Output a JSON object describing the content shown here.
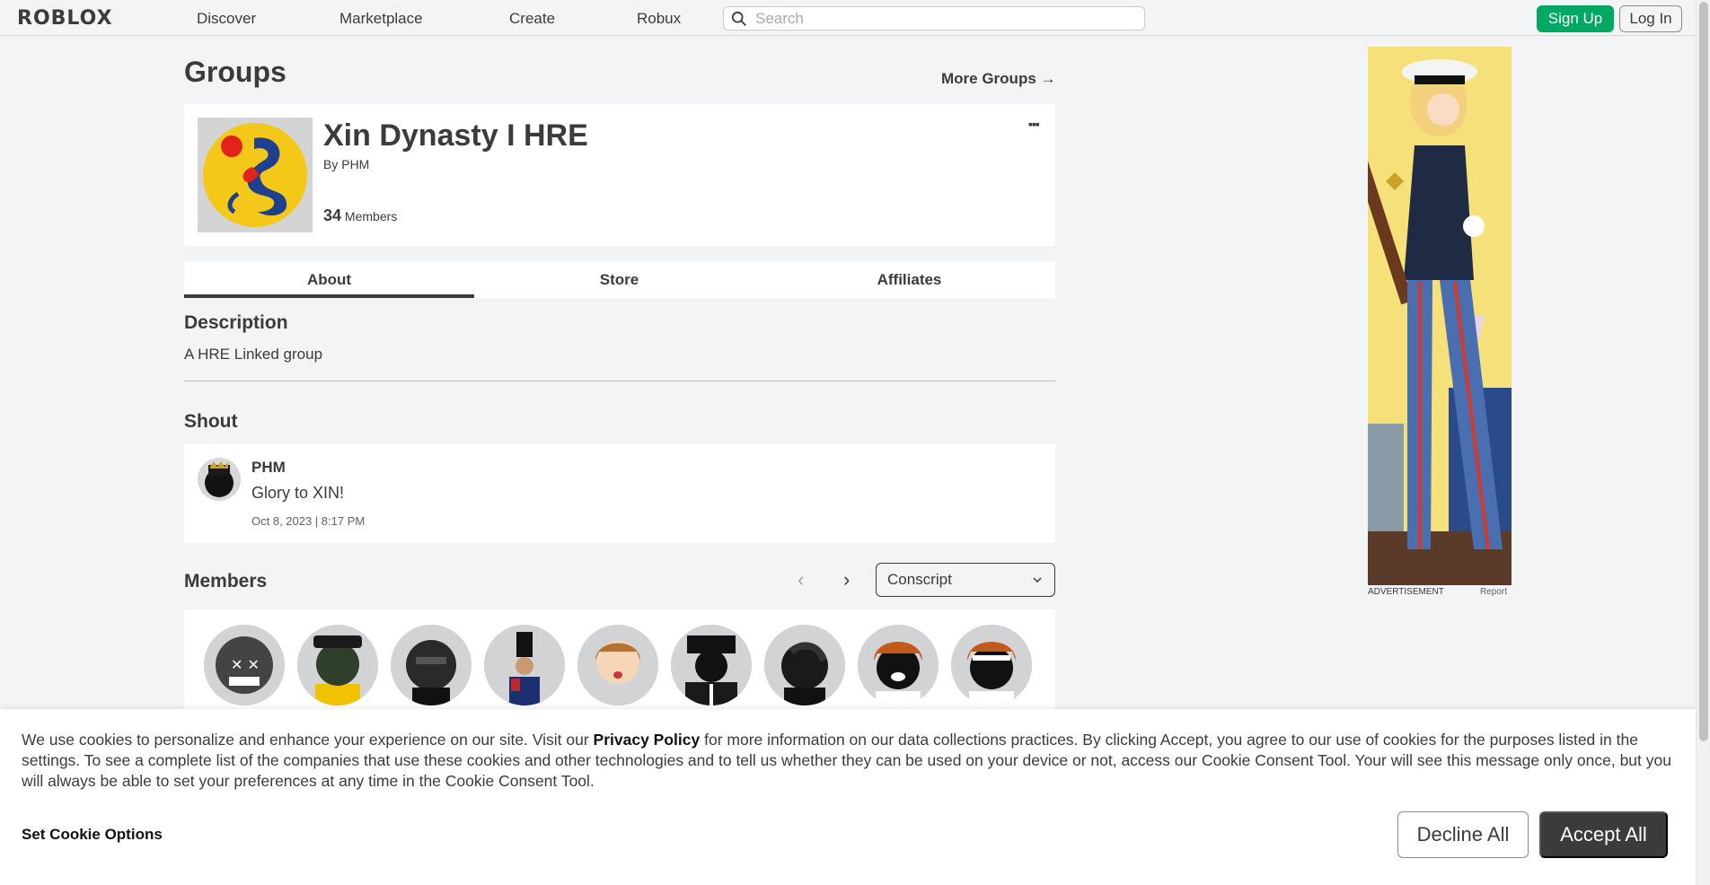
{
  "nav": {
    "logo": "ROBLOX",
    "links": [
      "Discover",
      "Marketplace",
      "Create",
      "Robux"
    ],
    "search_placeholder": "Search",
    "signup_label": "Sign Up",
    "login_label": "Log In"
  },
  "page": {
    "title": "Groups",
    "more_groups": "More Groups →"
  },
  "group": {
    "name": "Xin Dynasty I HRE",
    "by_prefix": "By",
    "owner": "PHM",
    "member_count": "34",
    "members_label": "Members",
    "menu_glyph": "▪▪▪"
  },
  "tabs": [
    {
      "label": "About",
      "active": true
    },
    {
      "label": "Store",
      "active": false
    },
    {
      "label": "Affiliates",
      "active": false
    }
  ],
  "description": {
    "title": "Description",
    "text": "A HRE Linked group"
  },
  "shout": {
    "title": "Shout",
    "user": "PHM",
    "body": "Glory to XIN!",
    "date": "Oct 8, 2023 | 8:17 PM"
  },
  "members": {
    "title": "Members",
    "role_selected": "Conscript",
    "avatar_count": 9
  },
  "ad": {
    "label": "ADVERTISEMENT",
    "report": "Report"
  },
  "cookie": {
    "text_before": "We use cookies to personalize and enhance your experience on our site. Visit our ",
    "privacy_link": "Privacy Policy",
    "text_after": " for more information on our data collections practices. By clicking Accept, you agree to our use of cookies for the purposes listed in the settings. To see a complete list of the companies that use these cookies and other technologies and to tell us whether they can be used on your device or not, access our Cookie Consent Tool. Your will see this message only once, but you will always be able to set your preferences at any time in the Cookie Consent Tool.",
    "set_options": "Set Cookie Options",
    "decline": "Decline All",
    "accept": "Accept All"
  },
  "colors": {
    "accent_green": "#00a862",
    "text_dark": "#393b3d",
    "page_bg": "#f2f4f5"
  }
}
